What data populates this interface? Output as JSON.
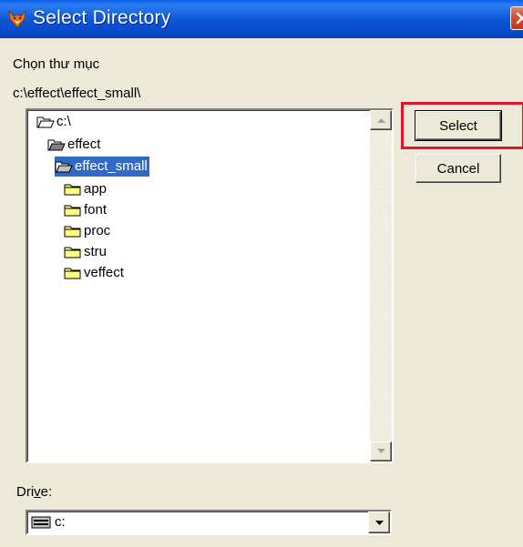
{
  "window": {
    "title": "Select Directory"
  },
  "labels": {
    "heading": "Chọn thư mục",
    "current_path": "c:\\effect\\effect_small\\",
    "drive_label_pre": "Dri",
    "drive_label_accel": "v",
    "drive_label_post": "e:"
  },
  "tree": {
    "root": "c:\\",
    "level1": "effect",
    "selected": "effect_small",
    "children": [
      "app",
      "font",
      "proc",
      "stru",
      "veffect"
    ]
  },
  "buttons": {
    "select": "Select",
    "cancel": "Cancel"
  },
  "drive": {
    "value": "c:"
  },
  "colors": {
    "title_bar": "#0a5fe8",
    "selection": "#316ac5",
    "highlight_outline": "#e3152e",
    "dialog_bg": "#ece9d8"
  }
}
